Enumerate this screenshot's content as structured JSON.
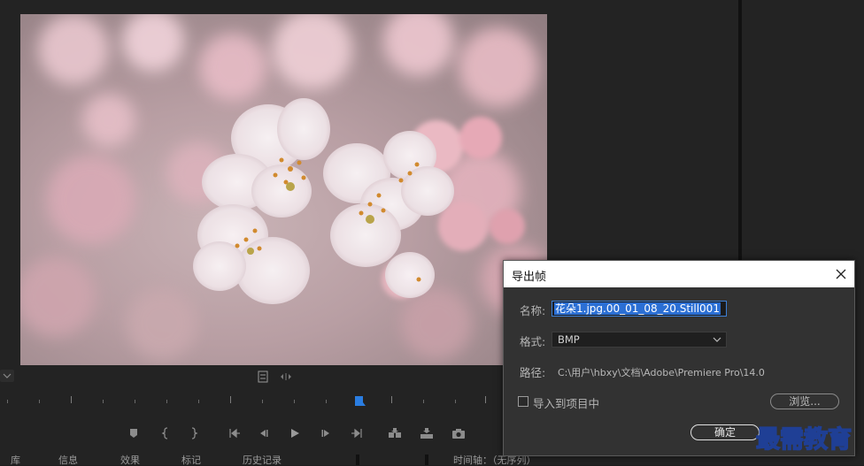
{
  "dialog": {
    "title": "导出帧",
    "name_label": "名称:",
    "name_value": "花朵1.jpg.00_01_08_20.Still001",
    "format_label": "格式:",
    "format_value": "BMP",
    "path_label": "路径:",
    "path_value": "C:\\用户\\hbxy\\文档\\Adobe\\Premiere Pro\\14.0",
    "import_label": "导入到项目中",
    "import_checked": false,
    "browse_label": "浏览...",
    "ok_label": "确定"
  },
  "watermark": "最需教育",
  "bottom_tabs": [
    "库",
    "信息",
    "效果",
    "标记",
    "历史记录",
    "时间轴：（无序列）"
  ],
  "transport_icons": [
    "add-marker-icon",
    "mark-in-icon",
    "mark-out-icon",
    "go-to-in-icon",
    "step-back-icon",
    "play-icon",
    "step-forward-icon",
    "go-to-out-icon",
    "insert-icon",
    "overwrite-icon",
    "export-frame-icon"
  ],
  "colors": {
    "accent": "#2b6fd4",
    "dialog_bg": "#323232",
    "panel_bg": "#232323"
  }
}
